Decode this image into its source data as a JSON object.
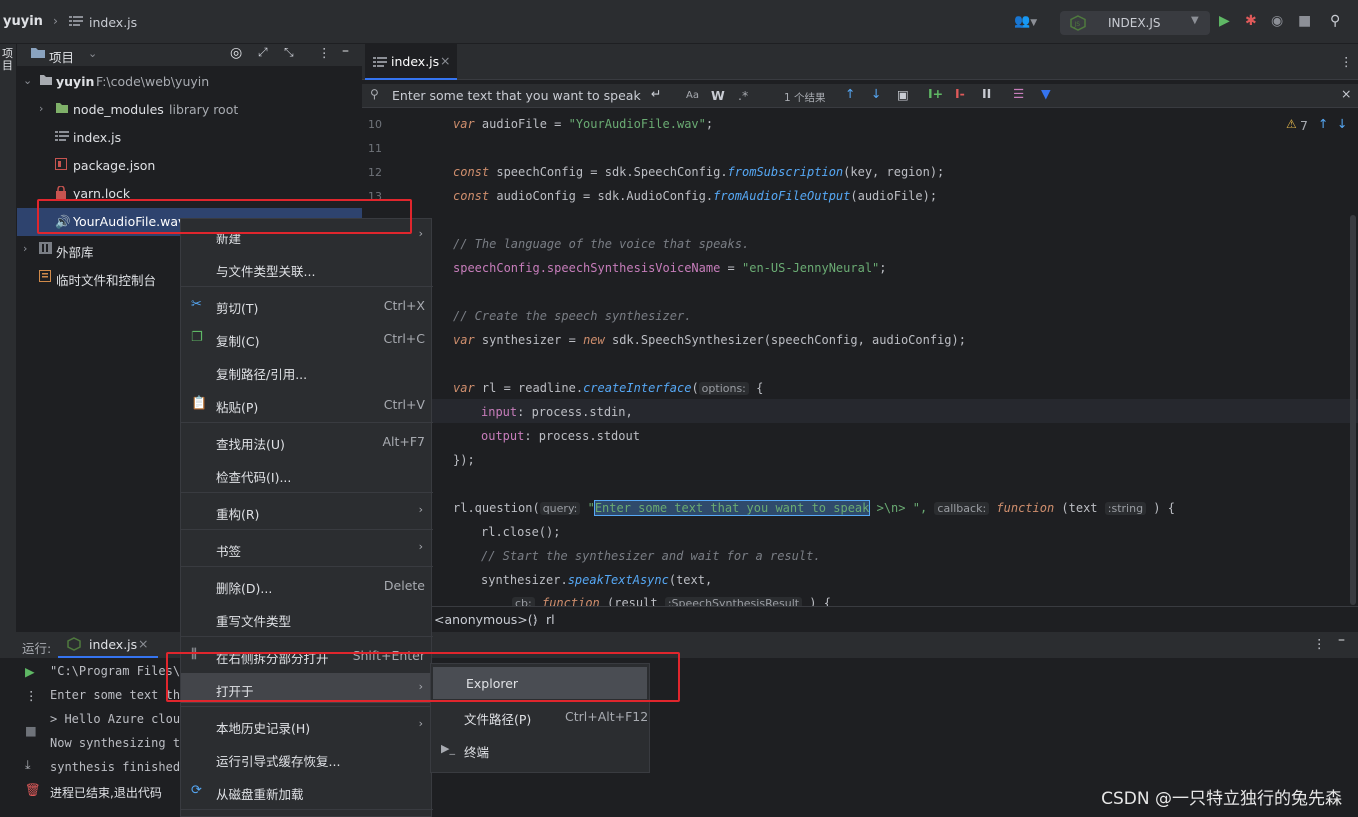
{
  "topbar": {
    "project": "yuyin",
    "file": "index.js",
    "run_config": "INDEX.JS"
  },
  "sidebar_strip": {
    "label": "项目"
  },
  "project_panel": {
    "title": "项目",
    "tree": [
      {
        "name": "yuyin",
        "path": "F:\\code\\web\\yuyin"
      },
      {
        "name": "node_modules",
        "extra": "library root"
      },
      {
        "name": "index.js"
      },
      {
        "name": "package.json"
      },
      {
        "name": "yarn.lock"
      },
      {
        "name": "YourAudioFile.wav"
      },
      {
        "name": "外部库"
      },
      {
        "name": "临时文件和控制台"
      }
    ]
  },
  "editor": {
    "tab": "index.js",
    "find": {
      "query": "Enter some text that you want to speak",
      "case_label": "Aa",
      "word_label": "W",
      "regex_label": ".*",
      "result": "1 个结果"
    },
    "warnings": "7",
    "line_numbers": [
      "10",
      "11",
      "12",
      "13"
    ],
    "code": {
      "l1_var": "var",
      "l1_rest": " audioFile = ",
      "l1_str": "\"YourAudioFile.wav\"",
      "l1_end": ";",
      "l2_const": "const",
      "l2_a": " speechConfig = sdk.SpeechConfig.",
      "l2_fn": "fromSubscription",
      "l2_b": "(key, region);",
      "l3_const": "const",
      "l3_a": " audioConfig = sdk.AudioConfig.",
      "l3_fn": "fromAudioFileOutput",
      "l3_b": "(audioFile);",
      "l4_cmt": "// The language of the voice that speaks.",
      "l5_a": "speechConfig.",
      "l5_prop": "speechSynthesisVoiceName",
      "l5_b": " = ",
      "l5_str": "\"en-US-JennyNeural\"",
      "l5_c": ";",
      "l6_cmt": "// Create the speech synthesizer.",
      "l7_var": "var",
      "l7_a": " synthesizer = ",
      "l7_new": "new",
      "l7_b": " sdk.SpeechSynthesizer(speechConfig, audioConfig);",
      "l8_var": "var",
      "l8_a": " rl = readline.",
      "l8_fn": "createInterface",
      "l8_b": "(",
      "l8_hint": "options:",
      "l8_c": " {",
      "l9_prop": "input",
      "l9_b": ": process.stdin,",
      "l10_prop": "output",
      "l10_b": ": process.stdout",
      "l11": "});",
      "l12_a": "rl.question(",
      "l12_hint": "query:",
      "l12_q": " \"",
      "l12_sel": "Enter some text that you want to speak",
      "l12_b": " >\\n> \", ",
      "l12_hint2": "callback:",
      "l12_fn": "function",
      "l12_c": " (text ",
      "l12_t": ":string",
      "l12_d": " ) {",
      "l13": "rl.close();",
      "l14_cmt": "// Start the synthesizer and wait for a result.",
      "l15_a": "synthesizer.",
      "l15_fn": "speakTextAsync",
      "l15_b": "(text,",
      "l16_hint": "cb:",
      "l16_fn": "function",
      "l16_b": " (result ",
      "l16_t": ":SpeechSynthesisResult",
      "l16_c": " ) {"
    },
    "breadcrumb": [
      "<anonymous>()",
      "rl"
    ]
  },
  "run_panel": {
    "title": "运行:",
    "tab": "index.js",
    "lines": [
      "\"C:\\Program Files\\",
      "Enter some text tha",
      "> Hello Azure cloud",
      "Now synthesizing to",
      "synthesis finished.",
      "进程已结束,退出代码"
    ]
  },
  "context_menu": {
    "items": [
      {
        "label": "新建",
        "shortcut": ""
      },
      {
        "label": "与文件类型关联...",
        "shortcut": ""
      },
      {
        "label": "剪切(T)",
        "shortcut": "Ctrl+X"
      },
      {
        "label": "复制(C)",
        "shortcut": "Ctrl+C"
      },
      {
        "label": "复制路径/引用...",
        "shortcut": ""
      },
      {
        "label": "粘贴(P)",
        "shortcut": "Ctrl+V"
      },
      {
        "label": "查找用法(U)",
        "shortcut": "Alt+F7"
      },
      {
        "label": "检查代码(I)...",
        "shortcut": ""
      },
      {
        "label": "重构(R)",
        "shortcut": ""
      },
      {
        "label": "书签",
        "shortcut": ""
      },
      {
        "label": "删除(D)...",
        "shortcut": "Delete"
      },
      {
        "label": "重写文件类型",
        "shortcut": ""
      },
      {
        "label": "在右侧拆分部分打开",
        "shortcut": "Shift+Enter"
      },
      {
        "label": "打开于",
        "shortcut": ""
      },
      {
        "label": "本地历史记录(H)",
        "shortcut": ""
      },
      {
        "label": "运行引导式缓存恢复...",
        "shortcut": ""
      },
      {
        "label": "从磁盘重新加载",
        "shortcut": ""
      }
    ]
  },
  "submenu": {
    "items": [
      {
        "label": "Explorer",
        "shortcut": ""
      },
      {
        "label": "文件路径(P)",
        "shortcut": "Ctrl+Alt+F12"
      },
      {
        "label": "终端",
        "shortcut": ""
      }
    ]
  },
  "watermark": "CSDN @一只特立独行的兔先森",
  "colors": {
    "accent": "#3574f0",
    "highlight_box": "#e0262d",
    "keyword": "#cf8e6d",
    "string": "#6aab73"
  }
}
